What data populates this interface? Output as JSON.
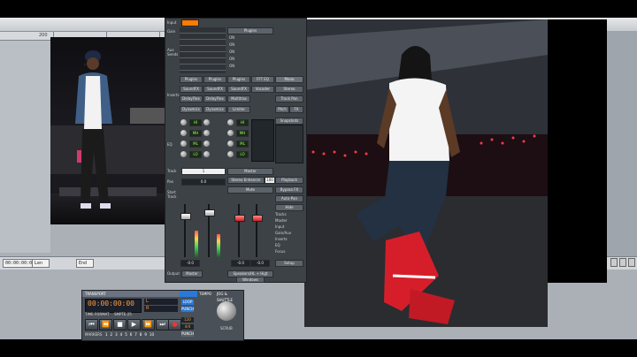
{
  "ruler": {
    "marker": "200"
  },
  "bottombar": {
    "time_start": "00:00:00:00",
    "loc_label": "Len",
    "end_label": "End"
  },
  "mixer": {
    "input_label": "Input",
    "gain_label": "Gain",
    "aux_sends_label": "Aux Sends",
    "plugins_header": "Plugins",
    "on_labels": [
      "ON",
      "ON",
      "ON",
      "ON",
      "ON"
    ],
    "inserts_label": "Inserts",
    "insert_slots": [
      "Plugins",
      "Plugins",
      "Plugins",
      "FFT EQ",
      "Mono",
      "SoundFX",
      "SoundFX",
      "SoundFX",
      "Vocoder",
      "Stereo",
      "DelayFlex",
      "DelayFlex",
      "Multitrax",
      "Track Pan",
      "Dynamics",
      "Dynamics",
      "Limiter",
      "Pitch",
      "FX"
    ],
    "eq_label": "EQ",
    "eq_values": [
      "HI",
      "MH",
      "ML",
      "LO"
    ],
    "snapshots_label": "Snapshots",
    "track_label": "Track",
    "track_value": "1",
    "master_label": "Master",
    "pan_label": "Pan",
    "pan_value": "0.0",
    "stereo_label": "Stereo Enhancer",
    "stereo_value": "100",
    "playback_label": "Playback",
    "start_track_label": "Start Track",
    "mute_label": "Mute",
    "bypass_label": "Bypass FX",
    "autopan_label": "Auto-Pan",
    "hide_label": "Hide",
    "routing_items": [
      "Tracks",
      "Master",
      "Input",
      "Gain/Aux",
      "Inserts",
      "EQ",
      "Focus"
    ],
    "fader_values": [
      "-0.0",
      "-0.0",
      "-0.0"
    ],
    "setup_label": "Setup",
    "output_label": "Output",
    "output_value": "Master",
    "speakers_value": "Speakers/HL + Higt",
    "windows_label": "Windows"
  },
  "transport": {
    "title": "TRANSPORT",
    "tempo_label": "TEMPO",
    "jog_label": "JOG & SHUTTLE",
    "time_value": "00:00:00:00",
    "time_format": "TIME FORMAT",
    "sync_label": "SMPTE 25",
    "markers_label": "MARKERS",
    "marker_numbers": [
      "1",
      "2",
      "3",
      "4",
      "5",
      "6",
      "7",
      "8",
      "9",
      "10"
    ],
    "loop_label": "LOOP",
    "punch_label": "PUNCH",
    "scrub_label": "SCRUB",
    "tempo_value": "120",
    "sig_value": "4/4",
    "l_label": "L",
    "r_label": "R"
  },
  "colors": {
    "accent_orange": "#ff7a00",
    "lcd_text": "#ff9a3c",
    "eq_green": "#9dff6a"
  }
}
